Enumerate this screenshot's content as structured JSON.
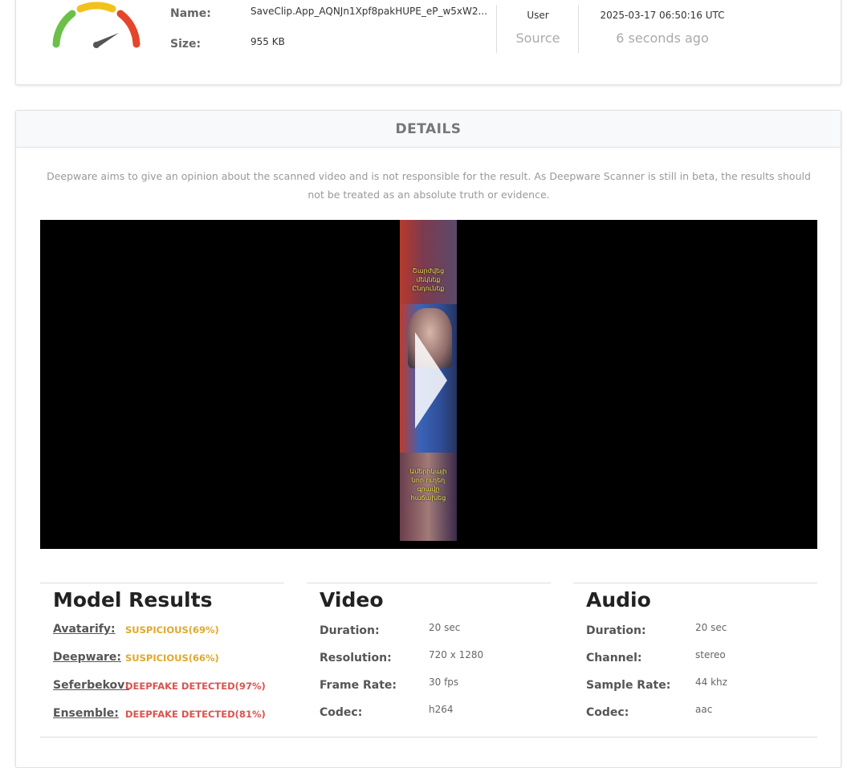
{
  "file": {
    "name_label": "Name:",
    "name_value": "SaveClip.App_AQNJn1Xpf8pakHUPE_eP_w5xW2...",
    "size_label": "Size:",
    "size_value": "955 KB",
    "user_label": "User",
    "source_label": "Source",
    "timestamp": "2025-03-17 06:50:16 UTC",
    "relative_time": "6 seconds ago"
  },
  "details": {
    "header": "DETAILS",
    "disclaimer": "Deepware aims to give an opinion about the scanned video and is not responsible for the result. As Deepware Scanner is still in beta, the results should not be treated as an absolute truth or evidence."
  },
  "video_captions": {
    "top": "Շարժվեց մեկնեք Ընդունեք",
    "bottom": "Ամերիկայի նոր ուղեղ գրավը հաճախեց"
  },
  "model_results": {
    "title": "Model Results",
    "items": [
      {
        "name": "Avatarify:",
        "result": "SUSPICIOUS(69%)",
        "level": "suspicious"
      },
      {
        "name": "Deepware:",
        "result": "SUSPICIOUS(66%)",
        "level": "suspicious"
      },
      {
        "name": "Seferbekov:",
        "result": "DEEPFAKE DETECTED(97%)",
        "level": "fake"
      },
      {
        "name": "Ensemble:",
        "result": "DEEPFAKE DETECTED(81%)",
        "level": "fake"
      }
    ]
  },
  "video": {
    "title": "Video",
    "rows": [
      {
        "label": "Duration:",
        "value": "20 sec"
      },
      {
        "label": "Resolution:",
        "value": "720 x 1280"
      },
      {
        "label": "Frame Rate:",
        "value": "30 fps"
      },
      {
        "label": "Codec:",
        "value": "h264"
      }
    ]
  },
  "audio": {
    "title": "Audio",
    "rows": [
      {
        "label": "Duration:",
        "value": "20 sec"
      },
      {
        "label": "Channel:",
        "value": "stereo"
      },
      {
        "label": "Sample Rate:",
        "value": "44 khz"
      },
      {
        "label": "Codec:",
        "value": "aac"
      }
    ]
  },
  "colors": {
    "suspicious": "#e1a82a",
    "fake": "#d9534f",
    "gauge_green": "#6cc04a",
    "gauge_yellow": "#f2c21b",
    "gauge_red": "#e5452b"
  }
}
